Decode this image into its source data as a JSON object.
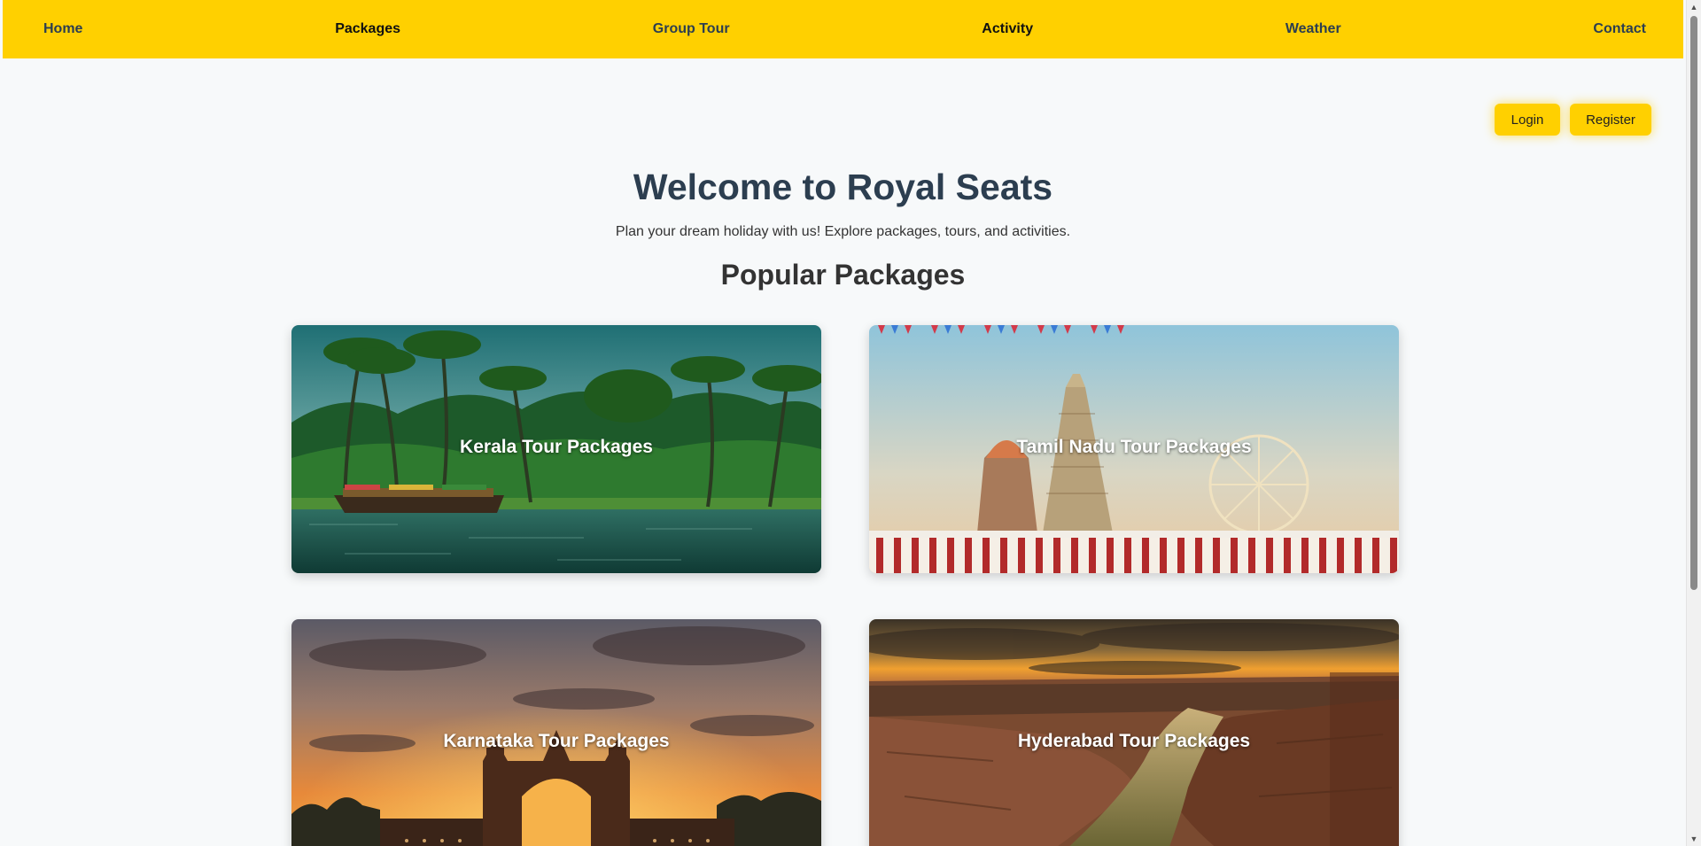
{
  "nav": {
    "home": "Home",
    "packages": "Packages",
    "group_tour": "Group Tour",
    "activity": "Activity",
    "weather": "Weather",
    "contact": "Contact"
  },
  "auth": {
    "login": "Login",
    "register": "Register"
  },
  "hero": {
    "title": "Welcome to Royal Seats",
    "subtitle": "Plan your dream holiday with us! Explore packages, tours, and activities."
  },
  "popular": {
    "title": "Popular Packages",
    "cards": [
      {
        "label": "Kerala Tour Packages"
      },
      {
        "label": "Tamil Nadu Tour Packages"
      },
      {
        "label": "Karnataka Tour Packages"
      },
      {
        "label": "Hyderabad Tour Packages"
      }
    ]
  },
  "colors": {
    "accent": "#ffd000",
    "heading": "#2c3e50",
    "background": "#f7f9fa"
  }
}
